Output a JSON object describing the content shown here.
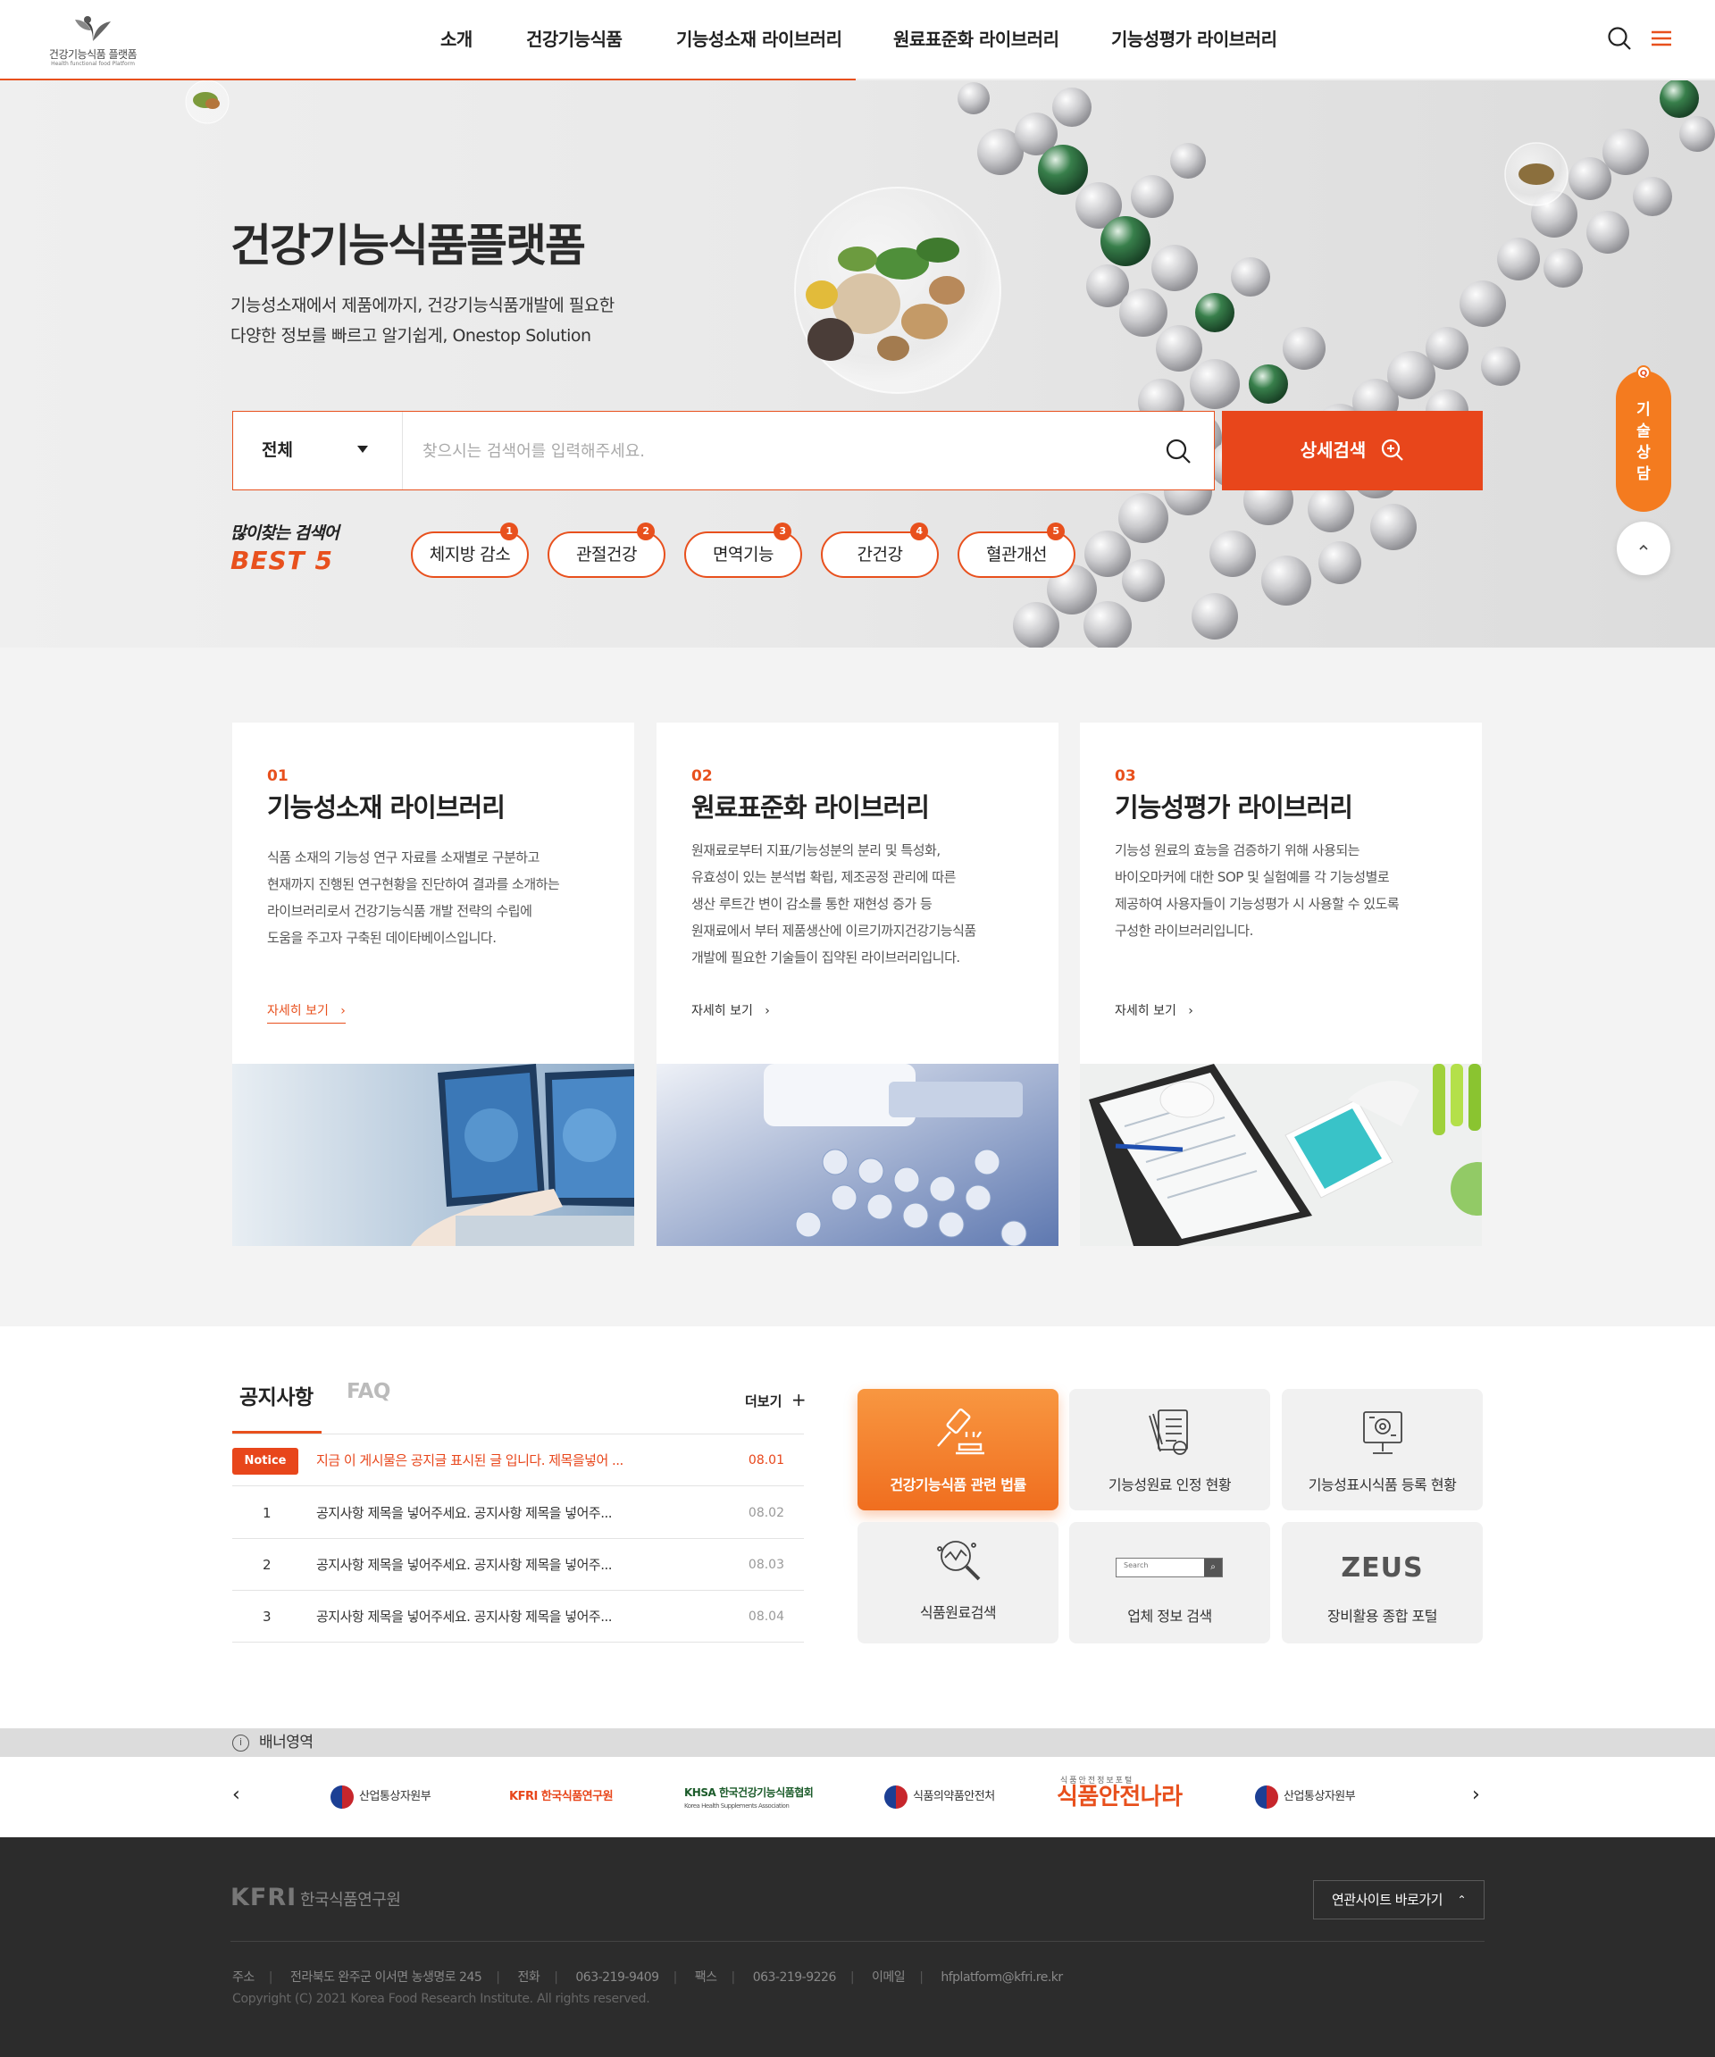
{
  "header": {
    "logo_text": "건강기능식품 플랫폼",
    "logo_sub": "Health functional food Platform",
    "nav": [
      "소개",
      "건강기능식품",
      "기능성소재 라이브러리",
      "원료표준화 라이브러리",
      "기능성평가 라이브러리"
    ]
  },
  "hero": {
    "title": "건강기능식품플랫폼",
    "desc_line1": "기능성소재에서 제품에까지, 건강기능식품개발에 필요한",
    "desc_line2": "다양한 정보를 빠르고 알기쉽게, Onestop Solution",
    "search": {
      "category": "전체",
      "placeholder": "찾으시는 검색어를 입력해주세요.",
      "advanced_label": "상세검색"
    },
    "best": {
      "label_line1": "많이찾는 검색어",
      "label_line2": "BEST 5",
      "keywords": [
        {
          "rank": "1",
          "text": "체지방 감소"
        },
        {
          "rank": "2",
          "text": "관절건강"
        },
        {
          "rank": "3",
          "text": "면역기능"
        },
        {
          "rank": "4",
          "text": "간건강"
        },
        {
          "rank": "5",
          "text": "혈관개선"
        }
      ]
    }
  },
  "side": {
    "tech_label_lines": [
      "기",
      "술",
      "상",
      "담"
    ],
    "tech_badge": "Q"
  },
  "cards": [
    {
      "num": "01",
      "title": "기능성소재 라이브러리",
      "desc": [
        "식품 소재의 기능성 연구 자료를 소재별로 구분하고",
        "현재까지 진행된 연구현황을 진단하여 결과를 소개하는",
        "라이브러리로서 건강기능식품 개발 전략의 수립에",
        "도움을 주고자 구축된 데이타베이스입니다."
      ],
      "more": "자세히 보기"
    },
    {
      "num": "02",
      "title": "원료표준화 라이브러리",
      "desc": [
        "원재료로부터 지표/기능성분의 분리 및 특성화,",
        "유효성이 있는 분석법 확립, 제조공정 관리에 따른",
        "생산 루트간 변이 감소를 통한 재현성 증가 등",
        "원재료에서 부터 제품생산에 이르기까지건강기능식품",
        "개발에 필요한 기술들이 집약된 라이브러리입니다."
      ],
      "more": "자세히 보기"
    },
    {
      "num": "03",
      "title": "기능성평가 라이브러리",
      "desc": [
        "기능성 원료의 효능을 검증하기 위해 사용되는",
        "바이오마커에 대한 SOP 및 실험예를 각 기능성별로",
        "제공하여 사용자들이 기능성평가 시 사용할 수 있도록",
        "구성한 라이브러리입니다."
      ],
      "more": "자세히 보기"
    }
  ],
  "board": {
    "tabs": [
      "공지사항",
      "FAQ"
    ],
    "more": "더보기",
    "notice_badge": "Notice",
    "rows": [
      {
        "idx": "",
        "title": "지금 이 게시물은 공지글 표시된 글 입니다. 제목을넣어 ...",
        "date": "08.01"
      },
      {
        "idx": "1",
        "title": "공지사항 제목을 넣어주세요. 공지사항 제목을 넣어주...",
        "date": "08.02"
      },
      {
        "idx": "2",
        "title": "공지사항 제목을 넣어주세요. 공지사항 제목을 넣어주...",
        "date": "08.03"
      },
      {
        "idx": "3",
        "title": "공지사항 제목을 넣어주세요. 공지사항 제목을 넣어주...",
        "date": "08.04"
      }
    ]
  },
  "quick": [
    {
      "label": "건강기능식품 관련 법률",
      "icon": "gavel-icon"
    },
    {
      "label": "기능성원료 인정 현황",
      "icon": "certificate-icon"
    },
    {
      "label": "기능성표시식품 등록 현황",
      "icon": "registration-monitor-icon"
    },
    {
      "label": "식품원료검색",
      "icon": "magnifier-chart-icon"
    },
    {
      "label": "업체 정보 검색",
      "icon": "search-bar-icon",
      "search_text": "Search"
    },
    {
      "label": "장비활용 종합 포털",
      "icon": "zeus-logo",
      "logo_text": "ZEUS"
    }
  ],
  "banner": {
    "label": "배너영역",
    "partners": [
      "산업통상자원부",
      "KFRI 한국식품연구원",
      "KHSA 한국건강기능식품협회",
      "식품의약품안전처",
      "식품안전나라",
      "산업통상자원부"
    ],
    "khsa_sub": "Korea Health Supplements Association",
    "foodsafety_top": "식품안전정보포털"
  },
  "footer": {
    "logo": "KFRI",
    "logo_kor": "한국식품연구원",
    "related_sites": "연관사이트 바로가기",
    "address_label": "주소",
    "address": "전라북도 완주군 이서면 농생명로 245",
    "phone_label": "전화",
    "phone": "063-219-9409",
    "fax_label": "팩스",
    "fax": "063-219-9226",
    "email_label": "이메일",
    "email": "hfplatform@kfri.re.kr",
    "copyright": "Copyright (C) 2021 Korea Food Research Institute. All rights reserved."
  },
  "colors": {
    "accent": "#e8501d",
    "accent_orange": "#f47b1f",
    "footer_bg": "#2c2c2c"
  }
}
